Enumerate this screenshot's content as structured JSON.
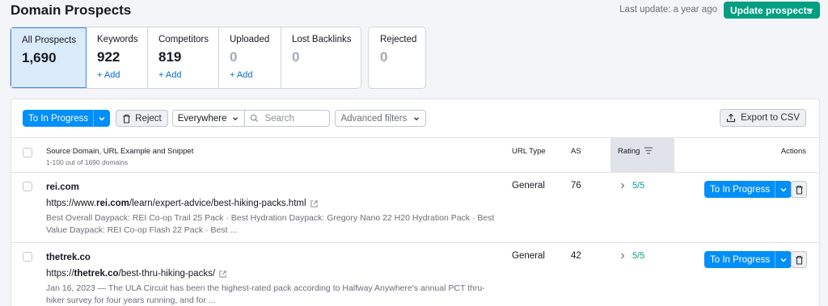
{
  "header": {
    "title": "Domain Prospects",
    "last_update": "Last update: a year ago",
    "update_button": "Update prospects"
  },
  "stats": {
    "all": {
      "label": "All Prospects",
      "value": "1,690"
    },
    "keywords": {
      "label": "Keywords",
      "value": "922",
      "add": "+ Add"
    },
    "competitors": {
      "label": "Competitors",
      "value": "819",
      "add": "+ Add"
    },
    "uploaded": {
      "label": "Uploaded",
      "value": "0",
      "add": "+ Add"
    },
    "lost": {
      "label": "Lost Backlinks",
      "value": "0"
    },
    "rejected": {
      "label": "Rejected",
      "value": "0"
    }
  },
  "toolbar": {
    "to_in_progress": "To In Progress",
    "reject": "Reject",
    "scope": "Everywhere",
    "search_placeholder": "Search",
    "advanced_filters": "Advanced filters",
    "export": "Export to CSV"
  },
  "table": {
    "col_source": "Source Domain, URL Example and Snippet",
    "count_text": "1-100 out of 1690 domains",
    "col_url_type": "URL Type",
    "col_as": "AS",
    "col_rating": "Rating",
    "col_actions": "Actions",
    "rows": [
      {
        "domain": "rei.com",
        "url_prefix": "https://www.",
        "url_bold": "rei.com",
        "url_suffix": "/learn/expert-advice/best-hiking-packs.html",
        "snippet": "Best Overall Daypack: REI Co-op Trail 25 Pack · Best Hydration Daypack: Gregory Nano 22 H20 Hydration Pack · Best Value Daypack: REI Co-op Flash 22 Pack · Best ...",
        "url_type": "General",
        "as": "76",
        "rating": "5",
        "rating_max": "/5",
        "action": "To In Progress"
      },
      {
        "domain": "thetrek.co",
        "url_prefix": "https://",
        "url_bold": "thetrek.co",
        "url_suffix": "/best-thru-hiking-packs/",
        "snippet": "Jan 16, 2023 — The ULA Circuit has been the highest-rated pack according to Halfway Anywhere's annual PCT thru-hiker survey for four years running, and for ...",
        "url_type": "General",
        "as": "42",
        "rating": "5",
        "rating_max": "/5",
        "action": "To In Progress"
      }
    ]
  }
}
